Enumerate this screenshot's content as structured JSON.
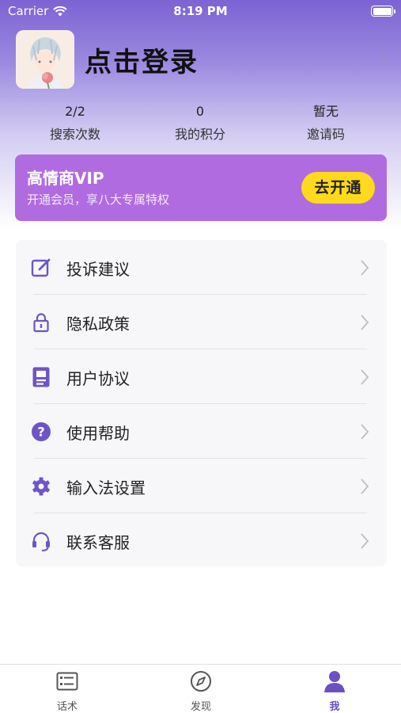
{
  "status_bar": {
    "carrier": "Carrier",
    "time": "8:19 PM"
  },
  "profile": {
    "login_label": "点击登录"
  },
  "stats": [
    {
      "value": "2/2",
      "label": "搜索次数"
    },
    {
      "value": "0",
      "label": "我的积分"
    },
    {
      "value": "暂无",
      "label": "邀请码"
    }
  ],
  "vip": {
    "title": "高情商VIP",
    "subtitle": "开通会员，享八大专属特权",
    "button": "去开通"
  },
  "menu": [
    {
      "label": "投诉建议",
      "icon": "edit-icon"
    },
    {
      "label": "隐私政策",
      "icon": "lock-icon"
    },
    {
      "label": "用户协议",
      "icon": "document-icon"
    },
    {
      "label": "使用帮助",
      "icon": "help-icon"
    },
    {
      "label": "输入法设置",
      "icon": "gear-icon"
    },
    {
      "label": "联系客服",
      "icon": "headset-icon"
    }
  ],
  "tabs": [
    {
      "label": "话术",
      "icon": "list-card-icon"
    },
    {
      "label": "发现",
      "icon": "compass-icon"
    },
    {
      "label": "我",
      "icon": "person-icon",
      "active": true
    }
  ],
  "colors": {
    "accent": "#7b5fd0",
    "vip_bg": "#b16be0",
    "vip_button": "#ffd91c",
    "tab_active": "#6b4fc4"
  }
}
